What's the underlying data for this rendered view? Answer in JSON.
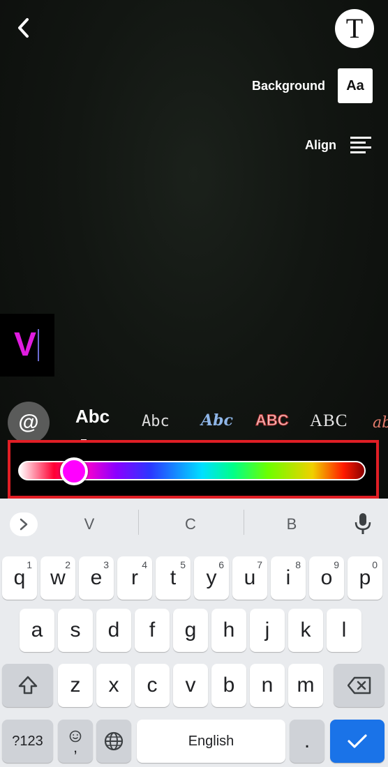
{
  "top_bar": {
    "back_icon": "chevron-left-icon",
    "text_tool_glyph": "T"
  },
  "options": {
    "background_label": "Background",
    "background_box_text": "Aa",
    "align_label": "Align",
    "align_icon": "align-left-icon"
  },
  "editor": {
    "typed_text": "V",
    "text_color": "#e01ce0"
  },
  "font_styles": {
    "mention_glyph": "@",
    "items": [
      "Abc",
      "Abc",
      "Abc",
      "ABC",
      "ABC",
      "ab"
    ]
  },
  "color_slider": {
    "selected_color": "#ff00ff",
    "position_fraction": 0.16,
    "highlight_color": "#e01e25"
  },
  "keyboard": {
    "suggestions": [
      "V",
      "C",
      "B"
    ],
    "row1": [
      {
        "key": "q",
        "hint": "1"
      },
      {
        "key": "w",
        "hint": "2"
      },
      {
        "key": "e",
        "hint": "3"
      },
      {
        "key": "r",
        "hint": "4"
      },
      {
        "key": "t",
        "hint": "5"
      },
      {
        "key": "y",
        "hint": "6"
      },
      {
        "key": "u",
        "hint": "7"
      },
      {
        "key": "i",
        "hint": "8"
      },
      {
        "key": "o",
        "hint": "9"
      },
      {
        "key": "p",
        "hint": "0"
      }
    ],
    "row2": [
      "a",
      "s",
      "d",
      "f",
      "g",
      "h",
      "j",
      "k",
      "l"
    ],
    "row3": [
      "z",
      "x",
      "c",
      "v",
      "b",
      "n",
      "m"
    ],
    "symbols_label": "?123",
    "emoji_extra": ",",
    "space_label": "English",
    "period": ".",
    "accent_color": "#1a73e8"
  }
}
